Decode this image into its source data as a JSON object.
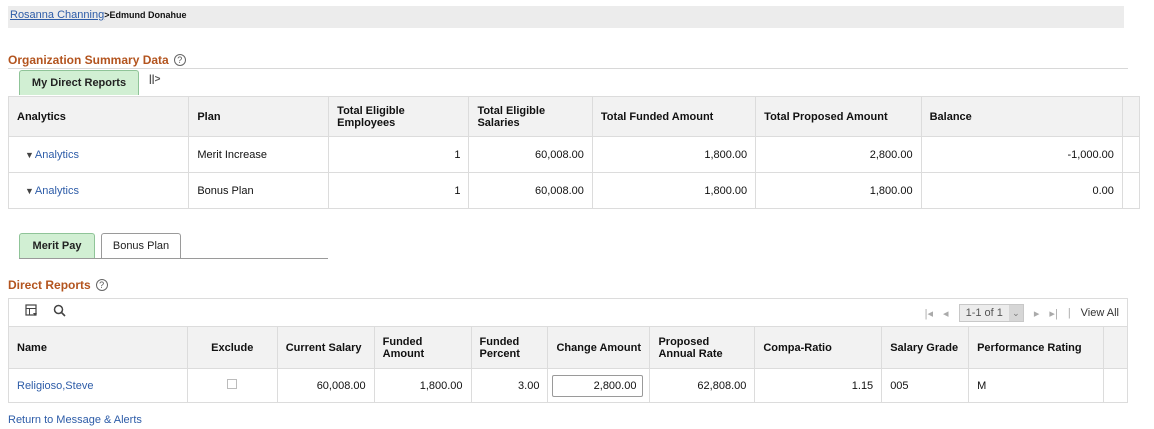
{
  "breadcrumb": {
    "parent": "Rosanna Channing",
    "separator": ">",
    "current": "Edmund Donahue"
  },
  "org_summary": {
    "title": "Organization Summary Data",
    "help": "?",
    "tab_label": "My Direct Reports",
    "tab_toggle": "||>",
    "columns": [
      "Analytics",
      "Plan",
      "Total Eligible Employees",
      "Total Eligible Salaries",
      "Total Funded Amount",
      "Total Proposed Amount",
      "Balance"
    ],
    "rows": [
      {
        "analytics": "Analytics",
        "plan": "Merit Increase",
        "employees": "1",
        "salaries": "60,008.00",
        "funded": "1,800.00",
        "proposed": "2,800.00",
        "balance": "-1,000.00"
      },
      {
        "analytics": "Analytics",
        "plan": "Bonus Plan",
        "employees": "1",
        "salaries": "60,008.00",
        "funded": "1,800.00",
        "proposed": "1,800.00",
        "balance": "0.00"
      }
    ]
  },
  "plan_tabs": [
    {
      "label": "Merit Pay",
      "active": true
    },
    {
      "label": "Bonus Plan",
      "active": false
    }
  ],
  "direct_reports": {
    "title": "Direct Reports",
    "help": "?",
    "pager": {
      "range": "1-1 of 1",
      "view_all": "View All",
      "divider": "|"
    },
    "columns": [
      "Name",
      "Exclude",
      "Current Salary",
      "Funded Amount",
      "Funded Percent",
      "Change Amount",
      "Proposed Annual Rate",
      "Compa-Ratio",
      "Salary Grade",
      "Performance Rating"
    ],
    "rows": [
      {
        "name": "Religioso,Steve",
        "exclude": false,
        "current_salary": "60,008.00",
        "funded_amount": "1,800.00",
        "funded_percent": "3.00",
        "change_amount": "2,800.00",
        "proposed_rate": "62,808.00",
        "compa_ratio": "1.15",
        "salary_grade": "005",
        "performance_rating": "M"
      }
    ]
  },
  "footer_link": "Return to Message & Alerts",
  "colors": {
    "section_title": "#b3541e",
    "link": "#2d5ca8",
    "active_tab": "#d1efd3"
  },
  "icons": {
    "help": "help-circle-icon",
    "grid_settings": "grid-settings-icon",
    "search": "search-icon",
    "first": "first-page-icon",
    "prev": "previous-page-icon",
    "next": "next-page-icon",
    "last": "last-page-icon",
    "expand": "triangle-down-icon"
  }
}
